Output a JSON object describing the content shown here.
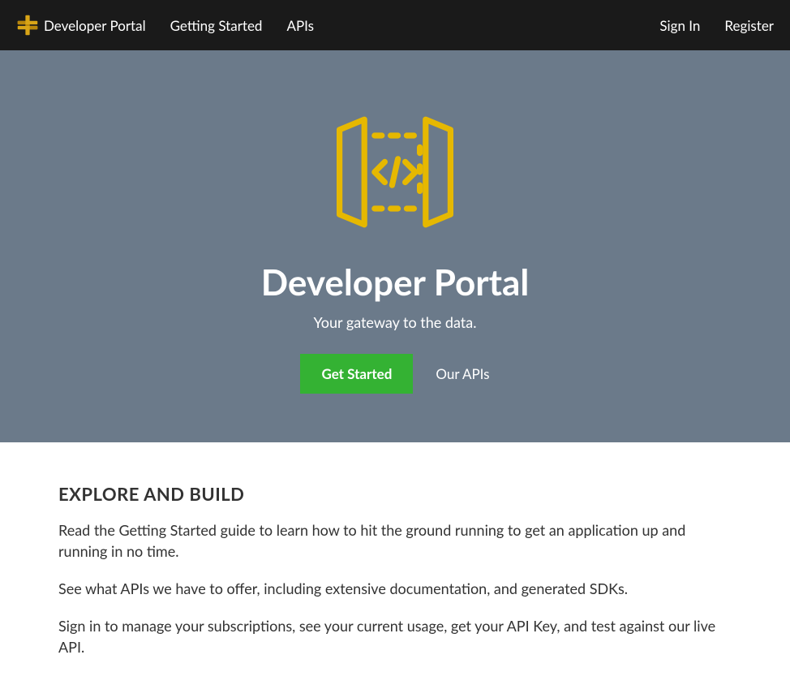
{
  "nav": {
    "brand": "Developer Portal",
    "links": {
      "getting_started": "Getting Started",
      "apis": "APIs"
    },
    "right": {
      "signin": "Sign In",
      "register": "Register"
    }
  },
  "hero": {
    "title": "Developer Portal",
    "subtitle": "Your gateway to the data.",
    "btn_primary": "Get Started",
    "btn_secondary": "Our APIs"
  },
  "content": {
    "heading": "EXPLORE AND BUILD",
    "para1": "Read the Getting Started guide to learn how to hit the ground running to get an application up and running in no time.",
    "para2": "See what APIs we have to offer, including extensive documentation, and generated SDKs.",
    "para3": "Sign in to manage your subscriptions, see your current usage, get your API Key, and test against our live API."
  },
  "colors": {
    "navbar_bg": "#1a1a1a",
    "hero_bg": "#6b7a8a",
    "accent_green": "#34b233",
    "accent_yellow": "#e6b800"
  }
}
